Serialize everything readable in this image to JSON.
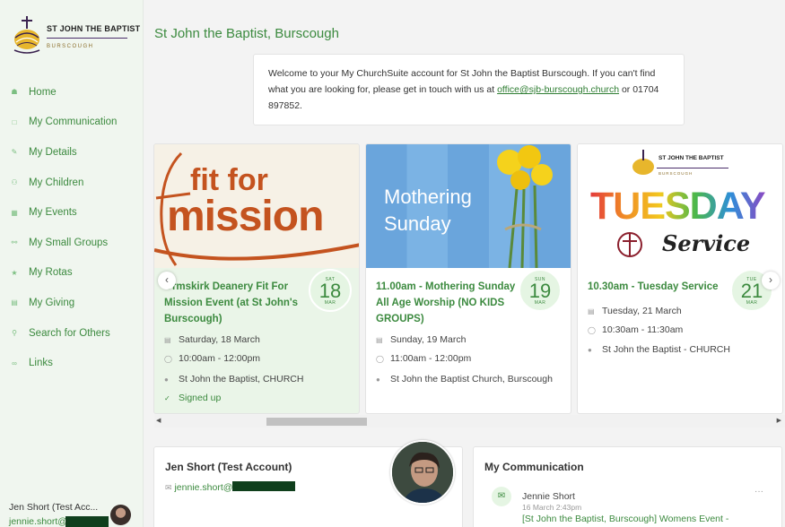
{
  "logo": {
    "name": "ST JOHN THE BAPTIST",
    "town": "BURSCOUGH"
  },
  "nav": [
    {
      "label": "Home",
      "icon": "home-icon"
    },
    {
      "label": "My Communication",
      "icon": "message-icon"
    },
    {
      "label": "My Details",
      "icon": "pencil-icon"
    },
    {
      "label": "My Children",
      "icon": "child-icon"
    },
    {
      "label": "My Events",
      "icon": "calendar-icon"
    },
    {
      "label": "My Small Groups",
      "icon": "group-icon"
    },
    {
      "label": "My Rotas",
      "icon": "star-icon"
    },
    {
      "label": "My Giving",
      "icon": "card-icon"
    },
    {
      "label": "Search for Others",
      "icon": "people-search-icon"
    },
    {
      "label": "Links",
      "icon": "link-icon"
    }
  ],
  "user": {
    "name": "Jen Short (Test Acc...",
    "email": "jennie.short@"
  },
  "page": {
    "title": "St John the Baptist, Burscough"
  },
  "welcome": {
    "text1": "Welcome to your My ChurchSuite account for St John the Baptist Burscough.  If you can't find what you are looking for, please get in touch with us at ",
    "email": "office@sjb-burscough.church",
    "text2": " or 01704 897852."
  },
  "events": [
    {
      "image_text": [
        "fit for",
        "mission"
      ],
      "title": "Ormskirk Deanery Fit For Mission Event (at St John's Burscough)",
      "date": "Saturday, 18 March",
      "time": "10:00am - 12:00pm",
      "location": "St John the Baptist, CHURCH",
      "status": "Signed up",
      "badge": {
        "dow": "SAT",
        "day": "18",
        "mon": "MAR"
      }
    },
    {
      "image_text": [
        "Mothering",
        "Sunday"
      ],
      "title": "11.00am - Mothering Sunday All Age Worship (NO KIDS GROUPS)",
      "date": "Sunday, 19 March",
      "time": "11:00am - 12:00pm",
      "location": "St John the Baptist Church, Burscough",
      "badge": {
        "dow": "SUN",
        "day": "19",
        "mon": "MAR"
      }
    },
    {
      "image_text": [
        "ST JOHN THE BAPTIST",
        "BURSCOUGH",
        "TUESDAY",
        "Service"
      ],
      "title": "10.30am - Tuesday Service",
      "date": "Tuesday, 21 March",
      "time": "10:30am - 11:30am",
      "location": "St John the Baptist - CHURCH",
      "badge": {
        "dow": "TUE",
        "day": "21",
        "mon": "MAR"
      }
    }
  ],
  "account": {
    "name": "Jen Short (Test Account)",
    "email": "jennie.short@"
  },
  "communication": {
    "heading": "My Communication",
    "from": "Jennie Short",
    "date": "16 March 2:43pm",
    "subject": "[St John the Baptist, Burscough] Womens Event -",
    "more": "···"
  },
  "colors": {
    "accent": "#3c8a3f",
    "sidebar_bg": "#f0f6ef",
    "badge_bg": "#e5f5e3",
    "fit_orange": "#c4531f",
    "sky_blue": "#78aee0"
  }
}
